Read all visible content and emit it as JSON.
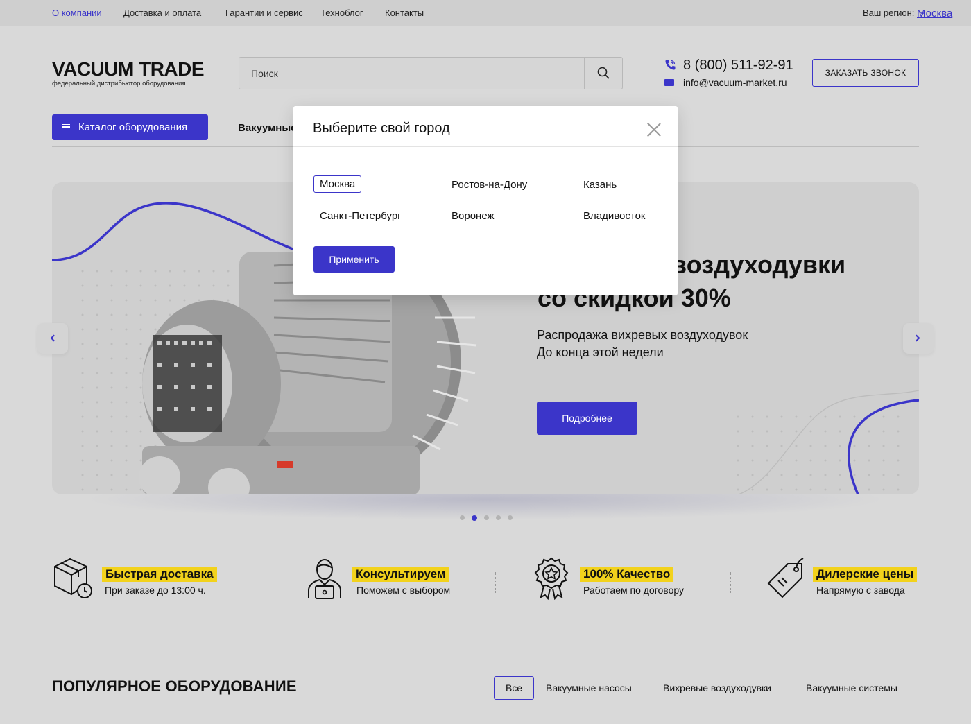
{
  "topbar": {
    "links": [
      "О компании",
      "Доставка и оплата",
      "Гарантии и сервис",
      "Техноблог",
      "Контакты"
    ],
    "region_label": "Ваш регион:",
    "region_city": "Москва"
  },
  "header": {
    "logo_name": "VACUUM TRADE",
    "logo_tagline": "федеральный дистрибьютор оборудования",
    "search_placeholder": "Поиск",
    "phone": "8 (800) 511-92-91",
    "email": "info@vacuum-market.ru",
    "callback_label": "ЗАКАЗАТЬ ЗВОНОК"
  },
  "nav": {
    "catalog_label": "Каталог оборудования",
    "first_item": "Вакуумные"
  },
  "hero": {
    "title_line1": "Вихревые воздуходувки",
    "title_line2": "со скидкой 30%",
    "sub_line1": "Распродажа вихревых воздуходувок",
    "sub_line2": "До конца этой недели",
    "button": "Подробнее",
    "slides_total": 5,
    "slide_active": 2
  },
  "features": [
    {
      "title": "Быстрая доставка",
      "subtitle": "При заказе до 13:00 ч.",
      "icon": "box-clock-icon"
    },
    {
      "title": "Консультируем",
      "subtitle": "Поможем с выбором",
      "icon": "consultant-icon"
    },
    {
      "title": "100% Качество",
      "subtitle": "Работаем по договору",
      "icon": "quality-badge-icon"
    },
    {
      "title": "Дилерские цены",
      "subtitle": "Напрямую с завода",
      "icon": "price-tag-icon"
    }
  ],
  "popular": {
    "title": "ПОПУЛЯРНОЕ ОБОРУДОВАНИЕ",
    "tabs": [
      "Все",
      "Вакуумные насосы",
      "Вихревые воздуходувки",
      "Вакуумные системы"
    ]
  },
  "modal": {
    "title": "Выберите свой город",
    "cities": [
      "Москва",
      "Ростов-на-Дону",
      "Казань",
      "Санкт-Петербург",
      "Воронеж",
      "Владивосток"
    ],
    "selected": "Москва",
    "apply_label": "Применить"
  },
  "colors": {
    "accent": "#3b35c9",
    "highlight": "#f2d21c",
    "background": "#d9d9d9"
  }
}
